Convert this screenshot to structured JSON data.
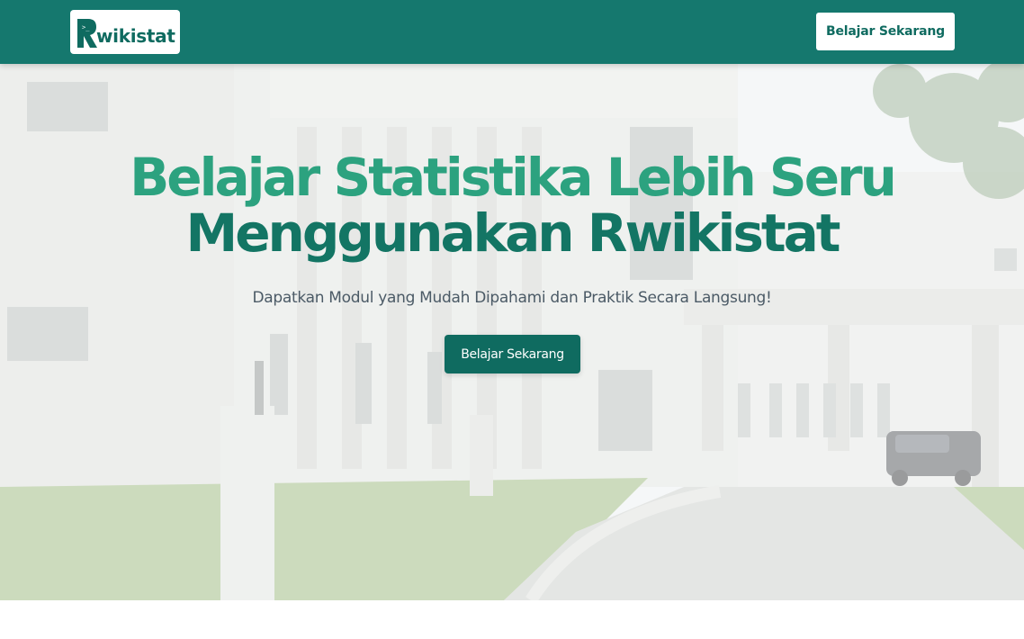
{
  "navbar": {
    "logo_text": "wikistat",
    "logo_glyph": ">_",
    "cta_label": "Belajar Sekarang",
    "background_color": "#15786e"
  },
  "hero": {
    "title_line1_part1": "Belajar",
    "title_line1_part2": "Statistika",
    "title_line1_part3": "Lebih Seru",
    "title_line2_part1": "Menggunakan",
    "title_line2_part2": "Rwikistat",
    "subtitle": "Dapatkan Modul yang Mudah Dipahami dan Praktik Secara Langsung!",
    "cta_label": "Belajar Sekarang",
    "accent_light": "#2ca27f",
    "accent_dark": "#137564"
  }
}
